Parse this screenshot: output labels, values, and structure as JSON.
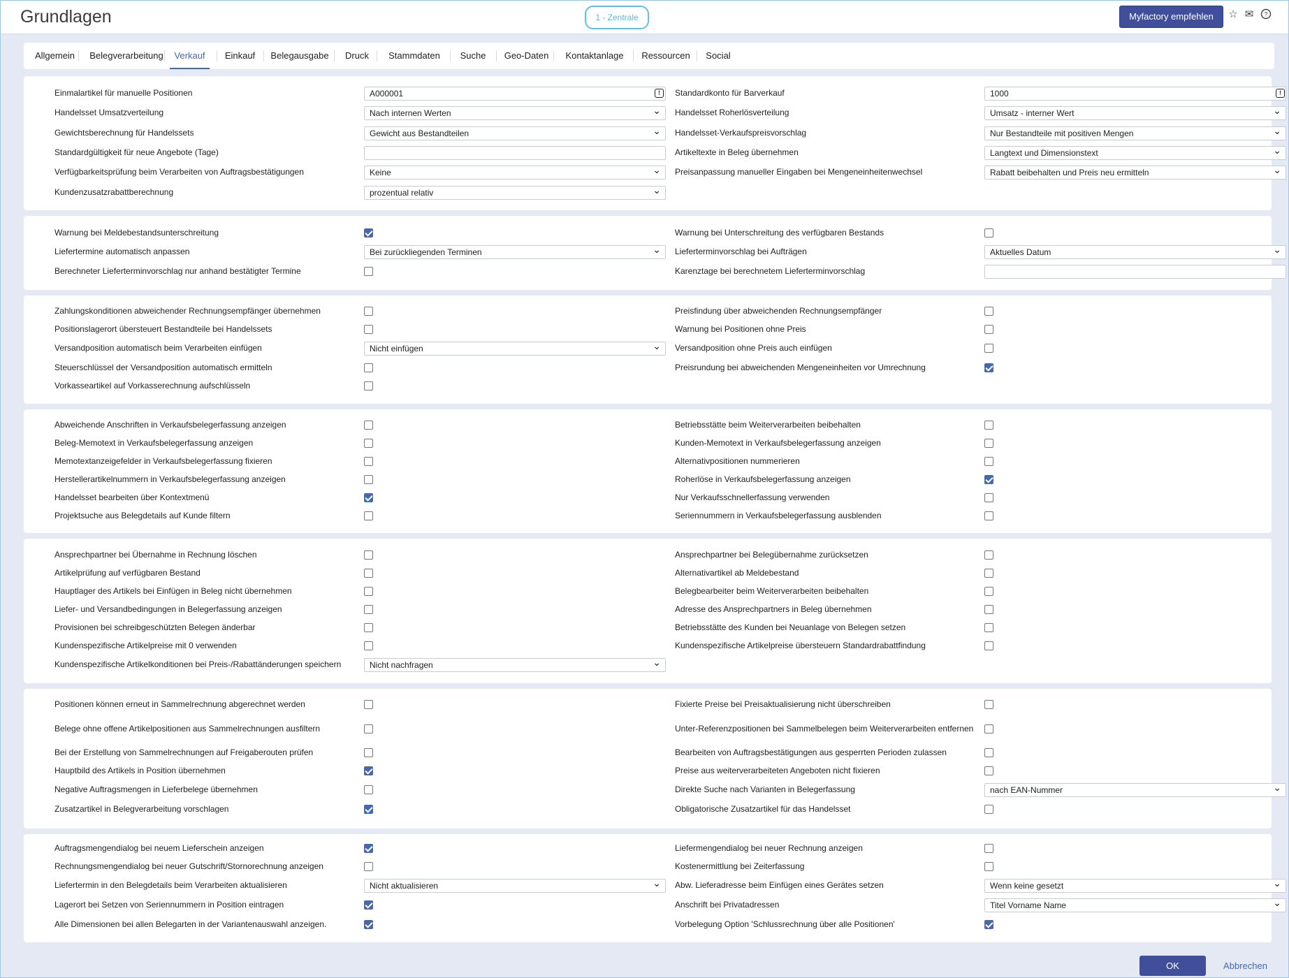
{
  "header": {
    "title": "Grundlagen",
    "client": "1 - Zentrale",
    "recommend_label": "Myfactory empfehlen",
    "icons": [
      "star-icon",
      "mail-icon",
      "help-icon"
    ]
  },
  "tabs": [
    "Allgemein",
    "Belegverarbeitung",
    "Verkauf",
    "Einkauf",
    "Belegausgabe",
    "Druck",
    "Stammdaten",
    "Suche",
    "Geo-Daten",
    "Kontaktanlage",
    "Ressourcen",
    "Social"
  ],
  "active_tab": "Verkauf",
  "panels": [
    {
      "rows": [
        {
          "left": {
            "label": "Einmalartikel für manuelle Positionen",
            "type": "text",
            "value": "A000001",
            "info": true
          },
          "right": {
            "label": "Standardkonto für Barverkauf",
            "type": "text",
            "value": "1000",
            "info": true
          }
        },
        {
          "left": {
            "label": "Handelsset Umsatzverteilung",
            "type": "select",
            "value": "Nach internen Werten"
          },
          "right": {
            "label": "Handelsset Roherlösverteilung",
            "type": "select",
            "value": "Umsatz - interner Wert"
          }
        },
        {
          "left": {
            "label": "Gewichtsberechnung für Handelssets",
            "type": "select",
            "value": "Gewicht aus Bestandteilen"
          },
          "right": {
            "label": "Handelsset-Verkaufspreisvorschlag",
            "type": "select",
            "value": "Nur Bestandteile mit positiven Mengen"
          }
        },
        {
          "left": {
            "label": "Standardgültigkeit für neue Angebote (Tage)",
            "type": "text",
            "value": ""
          },
          "right": {
            "label": "Artikeltexte in Beleg übernehmen",
            "type": "select",
            "value": "Langtext und Dimensionstext"
          }
        },
        {
          "left": {
            "label": "Verfügbarkeitsprüfung beim Verarbeiten von Auftragsbestätigungen",
            "type": "select",
            "value": "Keine"
          },
          "right": {
            "label": "Preisanpassung manueller Eingaben bei Mengeneinheitenwechsel",
            "type": "select",
            "value": "Rabatt beibehalten und Preis neu ermitteln"
          }
        },
        {
          "left": {
            "label": "Kundenzusatzrabattberechnung",
            "type": "select",
            "value": "prozentual relativ"
          }
        }
      ]
    },
    {
      "rows": [
        {
          "left": {
            "label": "Warnung bei Meldebestandsunterschreitung",
            "type": "check",
            "value": true
          },
          "right": {
            "label": "Warnung bei Unterschreitung des verfügbaren Bestands",
            "type": "check",
            "value": false
          }
        },
        {
          "left": {
            "label": "Liefertermine automatisch anpassen",
            "type": "select",
            "value": "Bei zurückliegenden Terminen"
          },
          "right": {
            "label": "Lieferterminvorschlag bei Aufträgen",
            "type": "select",
            "value": "Aktuelles Datum"
          }
        },
        {
          "left": {
            "label": "Berechneter Lieferterminvorschlag nur anhand bestätigter Termine",
            "type": "check",
            "value": false
          },
          "right": {
            "label": "Karenztage bei berechnetem Lieferterminvorschlag",
            "type": "text",
            "value": ""
          }
        }
      ]
    },
    {
      "rows": [
        {
          "left": {
            "label": "Zahlungskonditionen abweichender Rechnungsempfänger übernehmen",
            "type": "check",
            "value": false
          },
          "right": {
            "label": "Preisfindung über abweichenden Rechnungsempfänger",
            "type": "check",
            "value": false
          }
        },
        {
          "left": {
            "label": "Positionslagerort übersteuert Bestandteile bei Handelssets",
            "type": "check",
            "value": false
          },
          "right": {
            "label": "Warnung bei Positionen ohne Preis",
            "type": "check",
            "value": false
          }
        },
        {
          "left": {
            "label": "Versandposition automatisch beim Verarbeiten einfügen",
            "type": "select",
            "value": "Nicht einfügen"
          },
          "right": {
            "label": "Versandposition ohne Preis auch einfügen",
            "type": "check",
            "value": false
          }
        },
        {
          "left": {
            "label": "Steuerschlüssel der Versandposition automatisch ermitteln",
            "type": "check",
            "value": false
          },
          "right": {
            "label": "Preisrundung bei abweichenden Mengeneinheiten vor Umrechnung",
            "type": "check",
            "value": true
          }
        },
        {
          "left": {
            "label": "Vorkasseartikel auf Vorkasserechnung aufschlüsseln",
            "type": "check",
            "value": false
          }
        }
      ]
    },
    {
      "rows": [
        {
          "left": {
            "label": "Abweichende Anschriften in Verkaufsbelegerfassung anzeigen",
            "type": "check",
            "value": false
          },
          "right": {
            "label": "Betriebsstätte beim Weiterverarbeiten beibehalten",
            "type": "check",
            "value": false
          }
        },
        {
          "left": {
            "label": "Beleg-Memotext in Verkaufsbelegerfassung anzeigen",
            "type": "check",
            "value": false
          },
          "right": {
            "label": "Kunden-Memotext in Verkaufsbelegerfassung anzeigen",
            "type": "check",
            "value": false
          }
        },
        {
          "left": {
            "label": "Memotextanzeigefelder in Verkaufsbelegerfassung fixieren",
            "type": "check",
            "value": false
          },
          "right": {
            "label": "Alternativpositionen nummerieren",
            "type": "check",
            "value": false
          }
        },
        {
          "left": {
            "label": "Herstellerartikelnummern in Verkaufsbelegerfassung anzeigen",
            "type": "check",
            "value": false
          },
          "right": {
            "label": "Roherlöse in Verkaufsbelegerfassung anzeigen",
            "type": "check",
            "value": true
          }
        },
        {
          "left": {
            "label": "Handelsset bearbeiten über Kontextmenü",
            "type": "check",
            "value": true
          },
          "right": {
            "label": "Nur Verkaufsschnellerfassung verwenden",
            "type": "check",
            "value": false
          }
        },
        {
          "left": {
            "label": "Projektsuche aus Belegdetails auf Kunde filtern",
            "type": "check",
            "value": false
          },
          "right": {
            "label": "Seriennummern in Verkaufsbelegerfassung ausblenden",
            "type": "check",
            "value": false
          }
        }
      ]
    },
    {
      "rows": [
        {
          "left": {
            "label": "Ansprechpartner bei Übernahme in Rechnung löschen",
            "type": "check",
            "value": false
          },
          "right": {
            "label": "Ansprechpartner bei Belegübernahme zurücksetzen",
            "type": "check",
            "value": false
          }
        },
        {
          "left": {
            "label": "Artikelprüfung auf verfügbaren Bestand",
            "type": "check",
            "value": false
          },
          "right": {
            "label": "Alternativartikel ab Meldebestand",
            "type": "check",
            "value": false
          }
        },
        {
          "left": {
            "label": "Hauptlager des Artikels bei Einfügen in Beleg nicht übernehmen",
            "type": "check",
            "value": false
          },
          "right": {
            "label": "Belegbearbeiter beim Weiterverarbeiten beibehalten",
            "type": "check",
            "value": false
          }
        },
        {
          "left": {
            "label": "Liefer- und Versandbedingungen in Belegerfassung anzeigen",
            "type": "check",
            "value": false
          },
          "right": {
            "label": "Adresse des Ansprechpartners in Beleg übernehmen",
            "type": "check",
            "value": false
          }
        },
        {
          "left": {
            "label": "Provisionen bei schreibgeschützten Belegen änderbar",
            "type": "check",
            "value": false
          },
          "right": {
            "label": "Betriebsstätte des Kunden bei Neuanlage von Belegen setzen",
            "type": "check",
            "value": false
          }
        },
        {
          "left": {
            "label": "Kundenspezifische Artikelpreise mit 0 verwenden",
            "type": "check",
            "value": false
          },
          "right": {
            "label": "Kundenspezifische Artikelpreise übersteuern Standardrabattfindung",
            "type": "check",
            "value": false
          }
        },
        {
          "left": {
            "label": "Kundenspezifische Artikelkonditionen bei Preis-/Rabattänderungen speichern",
            "type": "select",
            "value": "Nicht nachfragen"
          }
        }
      ]
    },
    {
      "rows": [
        {
          "left": {
            "label": "Positionen können erneut in Sammelrechnung abgerechnet werden",
            "type": "check",
            "value": false
          },
          "right": {
            "label": "Fixierte Preise bei Preisaktualisierung nicht überschreiben",
            "type": "check",
            "value": false
          }
        },
        {
          "left": {
            "label": "Belege ohne offene Artikelpositionen aus Sammelrechnungen ausfiltern",
            "type": "check",
            "value": false
          },
          "right": {
            "label": "Unter-Referenzpositionen bei Sammelbelegen beim Weiterverarbeiten entfernen",
            "type": "check",
            "value": false
          }
        },
        {
          "left": {
            "label": "Bei der Erstellung von Sammelrechnungen auf Freigaberouten prüfen",
            "type": "check",
            "value": false
          },
          "right": {
            "label": "Bearbeiten von Auftragsbestätigungen aus gesperrten Perioden zulassen",
            "type": "check",
            "value": false
          }
        },
        {
          "left": {
            "label": "Hauptbild des Artikels in Position übernehmen",
            "type": "check",
            "value": true
          },
          "right": {
            "label": "Preise aus weiterverarbeiteten Angeboten nicht fixieren",
            "type": "check",
            "value": false
          }
        },
        {
          "left": {
            "label": "Negative Auftragsmengen in Lieferbelege übernehmen",
            "type": "check",
            "value": false
          },
          "right": {
            "label": "Direkte Suche nach Varianten in Belegerfassung",
            "type": "select",
            "value": "nach EAN-Nummer"
          }
        },
        {
          "left": {
            "label": "Zusatzartikel in Belegverarbeitung vorschlagen",
            "type": "check",
            "value": true
          },
          "right": {
            "label": "Obligatorische Zusatzartikel für das Handelsset",
            "type": "check",
            "value": false
          }
        }
      ]
    },
    {
      "rows": [
        {
          "left": {
            "label": "Auftragsmengendialog bei neuem Lieferschein anzeigen",
            "type": "check",
            "value": true
          },
          "right": {
            "label": "Liefermengendialog bei neuer Rechnung anzeigen",
            "type": "check",
            "value": false
          }
        },
        {
          "left": {
            "label": "Rechnungsmengendialog bei neuer Gutschrift/Stornorechnung anzeigen",
            "type": "check",
            "value": false
          },
          "right": {
            "label": "Kostenermittlung bei Zeiterfassung",
            "type": "check",
            "value": false
          }
        },
        {
          "left": {
            "label": "Liefertermin in den Belegdetails beim Verarbeiten aktualisieren",
            "type": "select",
            "value": "Nicht aktualisieren"
          },
          "right": {
            "label": "Abw. Lieferadresse beim Einfügen eines Gerätes setzen",
            "type": "select",
            "value": "Wenn keine gesetzt"
          }
        },
        {
          "left": {
            "label": "Lagerort bei Setzen von Seriennummern in Position eintragen",
            "type": "check",
            "value": true
          },
          "right": {
            "label": "Anschrift bei Privatadressen",
            "type": "select",
            "value": "Titel Vorname Name"
          }
        },
        {
          "left": {
            "label": "Alle Dimensionen bei allen Belegarten in der Variantenauswahl anzeigen.",
            "type": "check",
            "value": true
          },
          "right": {
            "label": "Vorbelegung Option 'Schlussrechnung über alle Positionen'",
            "type": "check",
            "value": true
          }
        }
      ]
    }
  ],
  "footer": {
    "ok_label": "OK",
    "cancel_label": "Abbrechen"
  }
}
